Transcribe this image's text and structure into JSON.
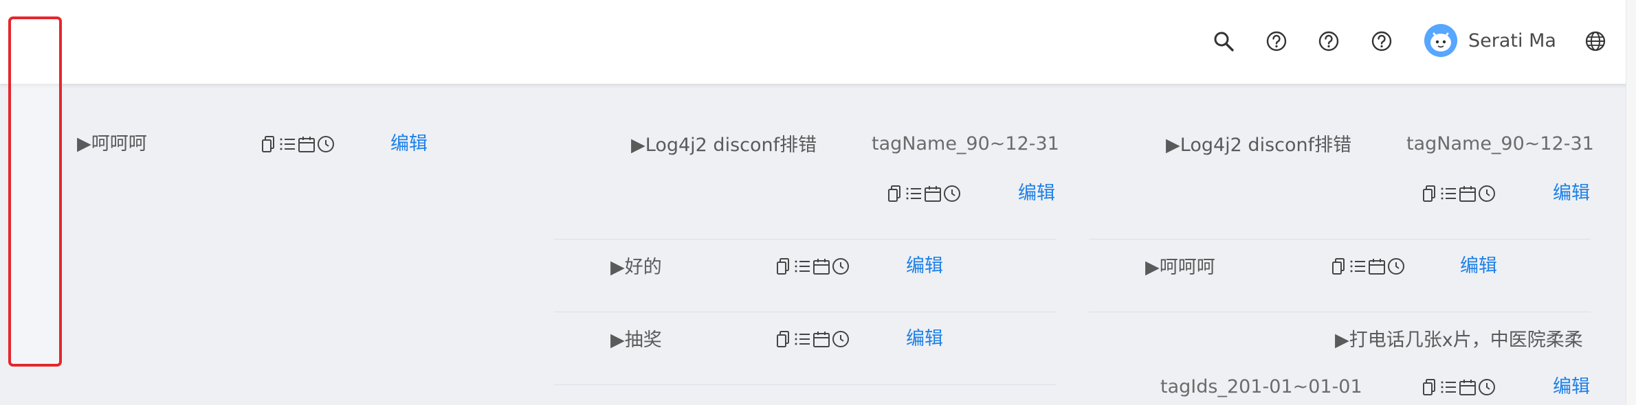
{
  "header": {
    "user_name": "Serati Ma",
    "icons": [
      "search-icon",
      "help-icon",
      "help-icon",
      "help-icon",
      "globe-icon"
    ],
    "accent_color": "#1e80e6",
    "avatar_color": "#57a6ff"
  },
  "edit_label": "编辑",
  "col1": {
    "rows": [
      {
        "title": "▶呵呵呵"
      }
    ]
  },
  "col2": {
    "rows": [
      {
        "title": "▶Log4j2 disconf排错",
        "tag": "tagName_90~12-31"
      },
      {
        "title": "▶好的"
      },
      {
        "title": "▶抽奖"
      }
    ]
  },
  "col3": {
    "rows": [
      {
        "title": "▶Log4j2 disconf排错",
        "tag": "tagName_90~12-31"
      },
      {
        "title": "▶呵呵呵"
      },
      {
        "title": "▶打电话几张x片，中医院柔柔",
        "tag": "tagIds_201-01~01-01"
      }
    ]
  },
  "highlight_color": "#e5262b"
}
